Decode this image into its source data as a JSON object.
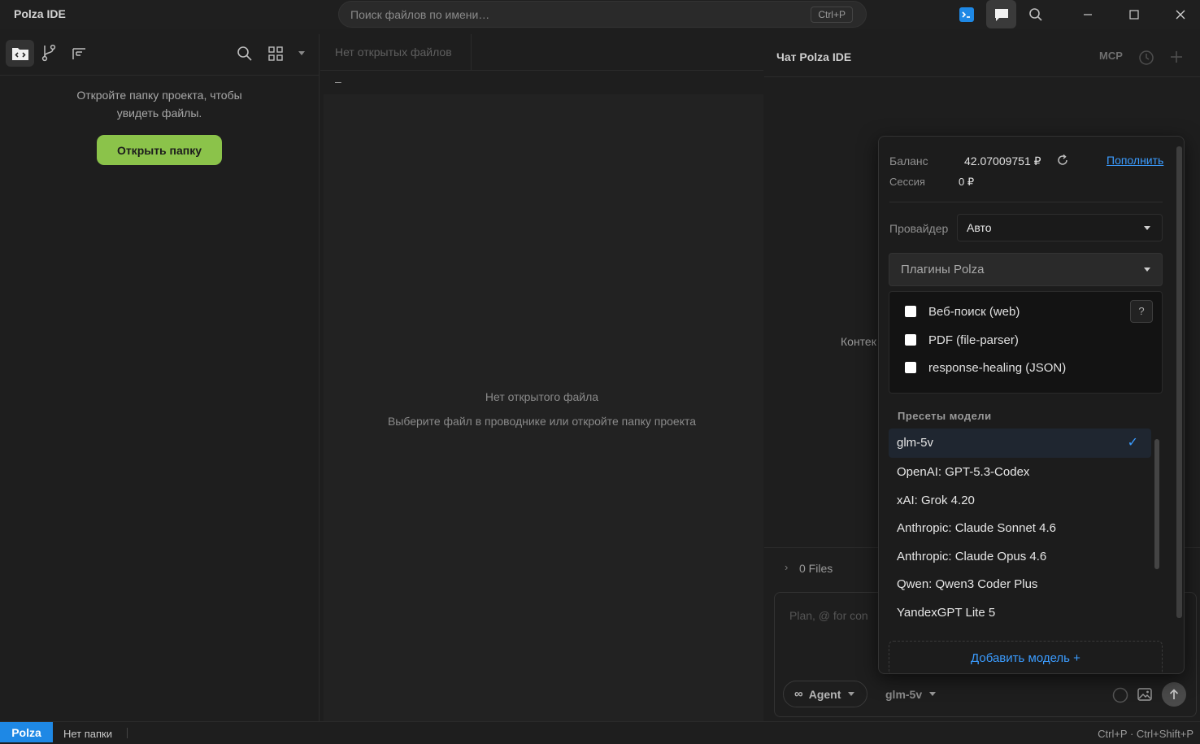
{
  "app": {
    "title": "Polza IDE"
  },
  "search": {
    "placeholder": "Поиск файлов по имени…",
    "shortcut": "Ctrl+P"
  },
  "explorer": {
    "empty_message": "Откройте папку проекта, чтобы увидеть файлы.",
    "open_folder_label": "Открыть папку"
  },
  "editor": {
    "no_tabs_label": "Нет открытых файлов",
    "breadcrumb": "–",
    "no_file_title": "Нет открытого файла",
    "no_file_hint": "Выберите файл в проводнике или откройте папку проекта"
  },
  "chat": {
    "title": "Чат Polza IDE",
    "mcp_label": "MCP",
    "context_label": "Контек",
    "files_label": "0 Files",
    "composer_placeholder": "Plan, @ for con",
    "agent_label": "Agent",
    "model_label": "glm-5v"
  },
  "popup": {
    "balance_label": "Баланс",
    "balance_value": "42.07009751 ₽",
    "topup_label": "Пополнить",
    "session_label": "Сессия",
    "session_value": "0 ₽",
    "provider_label": "Провайдер",
    "provider_value": "Авто",
    "plugins_label": "Плагины Polza",
    "plugins": [
      {
        "label": "Веб-поиск (web)",
        "checked": false
      },
      {
        "label": "PDF (file-parser)",
        "checked": false
      },
      {
        "label": "response-healing (JSON)",
        "checked": false
      }
    ],
    "help_label": "?",
    "presets_title": "Пресеты модели",
    "presets": [
      {
        "label": "glm-5v",
        "selected": true
      },
      {
        "label": "OpenAI: GPT-5.3-Codex",
        "selected": false
      },
      {
        "label": "xAI: Grok 4.20",
        "selected": false
      },
      {
        "label": "Anthropic: Claude Sonnet 4.6",
        "selected": false
      },
      {
        "label": "Anthropic: Claude Opus 4.6",
        "selected": false
      },
      {
        "label": "Qwen: Qwen3 Coder Plus",
        "selected": false
      },
      {
        "label": "YandexGPT Lite 5",
        "selected": false
      }
    ],
    "check_mark": "✓",
    "add_model_label": "Добавить модель  +"
  },
  "statusbar": {
    "brand": "Polza",
    "folder": "Нет папки",
    "shortcuts": "Ctrl+P · Ctrl+Shift+P"
  },
  "colors": {
    "accent": "#8bc34a",
    "link": "#3b9cff",
    "status_brand": "#1e88e5"
  }
}
